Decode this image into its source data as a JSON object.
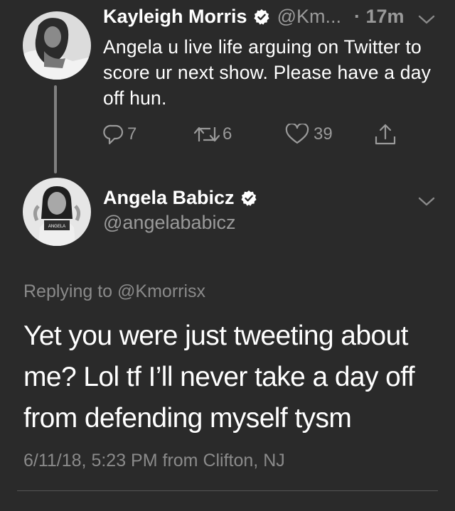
{
  "parent_tweet": {
    "author_name": "Kayleigh Morris",
    "handle": "@Km...",
    "time": "· 17m",
    "text": "Angela u live life arguing on Twitter to score ur next show. Please have a day off hun.",
    "replies": "7",
    "retweets": "6",
    "likes": "39"
  },
  "main_tweet": {
    "author_name": "Angela Babicz",
    "handle": "@angelababicz",
    "replying_prefix": "Replying to",
    "replying_handle": "@Kmorrisx",
    "text": "Yet you were just tweeting about me? Lol tf I’ll never take a day off from defending myself tysm",
    "timestamp": "6/11/18, 5:23 PM from Clifton, NJ"
  },
  "icons": {
    "verified": "verified-badge-icon",
    "reply": "reply-icon",
    "retweet": "retweet-icon",
    "like": "heart-icon",
    "share": "share-icon",
    "more": "chevron-down-icon"
  }
}
